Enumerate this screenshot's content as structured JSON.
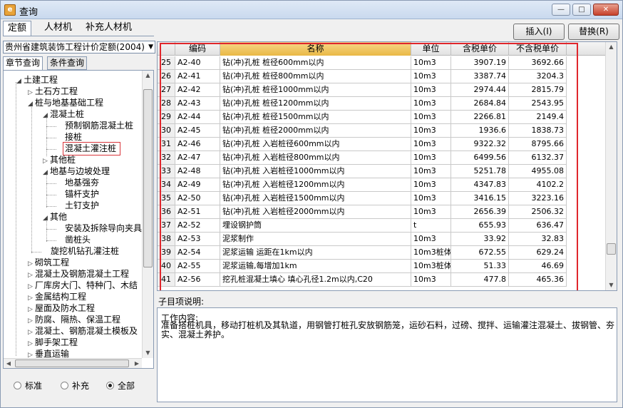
{
  "window": {
    "title": "查询",
    "app_icon": "app-logo-icon"
  },
  "top_tabs": [
    {
      "label": "定额"
    },
    {
      "label": "人材机"
    },
    {
      "label": "补充人材机"
    }
  ],
  "actions": {
    "insert_label": "插入(I)",
    "replace_label": "替换(R)"
  },
  "quota_select": {
    "value": "贵州省建筑装饰工程计价定额(2004)"
  },
  "sub_tabs": [
    {
      "label": "章节查询"
    },
    {
      "label": "条件查询"
    }
  ],
  "tree": [
    {
      "label": "土建工程",
      "expander": "◢"
    },
    {
      "label": "土石方工程",
      "expander": "▷"
    },
    {
      "label": "桩与地基基础工程",
      "expander": "◢"
    },
    {
      "label": "混凝土桩",
      "expander": "◢"
    },
    {
      "label": "预制钢筋混凝土桩",
      "expander": ""
    },
    {
      "label": "接桩",
      "expander": ""
    },
    {
      "label": "混凝土灌注桩",
      "expander": ""
    },
    {
      "label": "其他桩",
      "expander": "▷"
    },
    {
      "label": "地基与边坡处理",
      "expander": "◢"
    },
    {
      "label": "地基强夯",
      "expander": ""
    },
    {
      "label": "锚杆支护",
      "expander": ""
    },
    {
      "label": "土钉支护",
      "expander": ""
    },
    {
      "label": "其他",
      "expander": "◢"
    },
    {
      "label": "安装及拆除导向夹具",
      "expander": ""
    },
    {
      "label": "凿桩头",
      "expander": ""
    },
    {
      "label": "旋挖机钻孔灌注桩",
      "expander": ""
    },
    {
      "label": "砌筑工程",
      "expander": "▷"
    },
    {
      "label": "混凝土及钢筋混凝土工程",
      "expander": "▷"
    },
    {
      "label": "厂库房大门、特种门、木结",
      "expander": "▷"
    },
    {
      "label": "金属结构工程",
      "expander": "▷"
    },
    {
      "label": "屋面及防水工程",
      "expander": "▷"
    },
    {
      "label": "防腐、隔热、保温工程",
      "expander": "▷"
    },
    {
      "label": "混凝土、钢筋混凝土模板及",
      "expander": "▷"
    },
    {
      "label": "脚手架工程",
      "expander": "▷"
    },
    {
      "label": "垂直运输",
      "expander": "▷"
    }
  ],
  "radio": [
    {
      "label": "标准",
      "checked": false
    },
    {
      "label": "补充",
      "checked": false
    },
    {
      "label": "全部",
      "checked": true
    }
  ],
  "grid": {
    "columns": [
      "编码",
      "名称",
      "单位",
      "含税单价",
      "不含税单价"
    ],
    "rows": [
      {
        "idx": "25",
        "code": "A2-40",
        "name": "钻(冲)孔桩 桩径600mm以内",
        "unit": "10m3",
        "price_tax": "3907.19",
        "price_notax": "3692.66"
      },
      {
        "idx": "26",
        "code": "A2-41",
        "name": "钻(冲)孔桩 桩径800mm以内",
        "unit": "10m3",
        "price_tax": "3387.74",
        "price_notax": "3204.3"
      },
      {
        "idx": "27",
        "code": "A2-42",
        "name": "钻(冲)孔桩 桩径1000mm以内",
        "unit": "10m3",
        "price_tax": "2974.44",
        "price_notax": "2815.79"
      },
      {
        "idx": "28",
        "code": "A2-43",
        "name": "钻(冲)孔桩 桩径1200mm以内",
        "unit": "10m3",
        "price_tax": "2684.84",
        "price_notax": "2543.95"
      },
      {
        "idx": "29",
        "code": "A2-44",
        "name": "钻(冲)孔桩 桩径1500mm以内",
        "unit": "10m3",
        "price_tax": "2266.81",
        "price_notax": "2149.4"
      },
      {
        "idx": "30",
        "code": "A2-45",
        "name": "钻(冲)孔桩 桩径2000mm以内",
        "unit": "10m3",
        "price_tax": "1936.6",
        "price_notax": "1838.73"
      },
      {
        "idx": "31",
        "code": "A2-46",
        "name": "钻(冲)孔桩 入岩桩径600mm以内",
        "unit": "10m3",
        "price_tax": "9322.32",
        "price_notax": "8795.66"
      },
      {
        "idx": "32",
        "code": "A2-47",
        "name": "钻(冲)孔桩 入岩桩径800mm以内",
        "unit": "10m3",
        "price_tax": "6499.56",
        "price_notax": "6132.37"
      },
      {
        "idx": "33",
        "code": "A2-48",
        "name": "钻(冲)孔桩 入岩桩径1000mm以内",
        "unit": "10m3",
        "price_tax": "5251.78",
        "price_notax": "4955.08"
      },
      {
        "idx": "34",
        "code": "A2-49",
        "name": "钻(冲)孔桩 入岩桩径1200mm以内",
        "unit": "10m3",
        "price_tax": "4347.83",
        "price_notax": "4102.2"
      },
      {
        "idx": "35",
        "code": "A2-50",
        "name": "钻(冲)孔桩 入岩桩径1500mm以内",
        "unit": "10m3",
        "price_tax": "3416.15",
        "price_notax": "3223.16"
      },
      {
        "idx": "36",
        "code": "A2-51",
        "name": "钻(冲)孔桩 入岩桩径2000mm以内",
        "unit": "10m3",
        "price_tax": "2656.39",
        "price_notax": "2506.32"
      },
      {
        "idx": "37",
        "code": "A2-52",
        "name": "埋设钢护筒",
        "unit": "t",
        "price_tax": "655.93",
        "price_notax": "636.47"
      },
      {
        "idx": "38",
        "code": "A2-53",
        "name": "泥浆制作",
        "unit": "10m3",
        "price_tax": "33.92",
        "price_notax": "32.83"
      },
      {
        "idx": "39",
        "code": "A2-54",
        "name": "泥浆运输 运距在1km以内",
        "unit": "10m3桩体",
        "price_tax": "672.55",
        "price_notax": "629.24"
      },
      {
        "idx": "40",
        "code": "A2-55",
        "name": "泥浆运输,每增加1km",
        "unit": "10m3桩体",
        "price_tax": "51.33",
        "price_notax": "46.69"
      },
      {
        "idx": "41",
        "code": "A2-56",
        "name": "挖孔桩混凝土填心 填心孔径1.2m以内,C20",
        "unit": "10m3",
        "price_tax": "477.8",
        "price_notax": "465.36"
      }
    ]
  },
  "description": {
    "label": "子目项说明:",
    "title": "工作内容:",
    "body": "准备搭桩机具，移动打桩机及其轨道，用钢管打桩孔安放钢筋笼，运砂石料，过磅、搅拌、运输灌注混凝土、拔钢管、夯实、混凝土养护。"
  }
}
